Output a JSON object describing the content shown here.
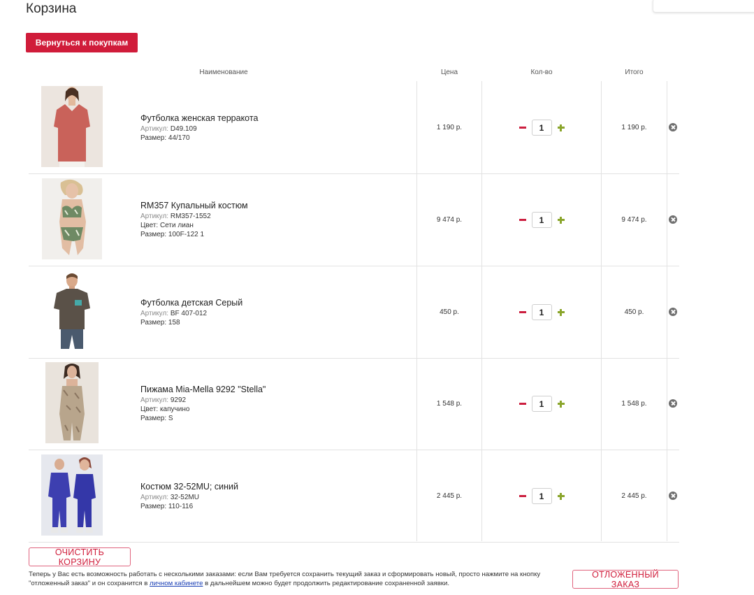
{
  "page": {
    "title": "Корзина"
  },
  "back_button": "Вернуться к покупкам",
  "columns": {
    "name": "Наименование",
    "price": "Цена",
    "qty": "Кол-во",
    "total": "Итого"
  },
  "labels": {
    "article": "Артикул:"
  },
  "items": [
    {
      "name": "Футболка женская терракота",
      "article": "D49.109",
      "props": [
        "Размер: 44/170"
      ],
      "price": "1 190 р.",
      "qty": "1",
      "total": "1 190 р."
    },
    {
      "name": "RM357 Купальный костюм",
      "article": "RM357-1552",
      "props": [
        "Цвет: Сети лиан",
        "Размер: 100F-122 1"
      ],
      "price": "9 474 р.",
      "qty": "1",
      "total": "9 474 р."
    },
    {
      "name": "Футболка детская Серый",
      "article": "BF 407-012",
      "props": [
        "Размер: 158"
      ],
      "price": "450 р.",
      "qty": "1",
      "total": "450 р."
    },
    {
      "name": "Пижама Mia-Mella 9292 \"Stella\"",
      "article": "9292",
      "props": [
        "Цвет: капучино",
        "Размер: S"
      ],
      "price": "1 548 р.",
      "qty": "1",
      "total": "1 548 р."
    },
    {
      "name": "Костюм 32-52MU; синий",
      "article": "32-52MU",
      "props": [
        "Размер: 110-116"
      ],
      "price": "2 445 р.",
      "qty": "1",
      "total": "2 445 р."
    }
  ],
  "clear_button": "ОЧИСТИТЬ КОРЗИНУ",
  "saved_order_button": "ОТЛОЖЕННЫЙ ЗАКАЗ",
  "note": {
    "before_link": "Теперь у Вас есть возможность работать с несколькими заказами: если Вам требуется сохранить текущий заказ и сформировать новый, просто нажмите на кнопку \"отложенный заказ\" и он сохранится в ",
    "link": "личном кабинете",
    "after_link": " в дальнейшем можно будет продолжить редактирование сохраненной заявки."
  },
  "colors": {
    "accent": "#d01c3a",
    "plus": "#8aa52b",
    "link": "#1a3fb5"
  }
}
